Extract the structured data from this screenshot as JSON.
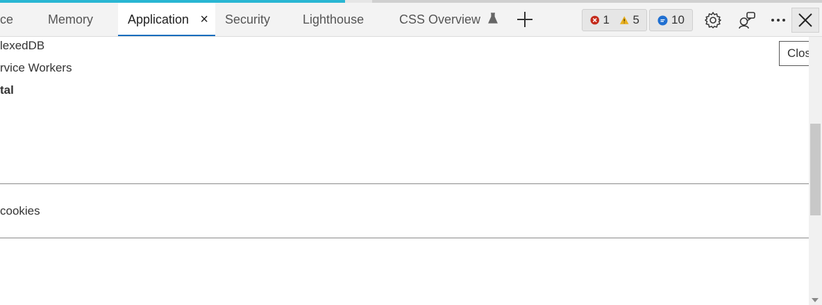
{
  "tabs": [
    {
      "label": "ce"
    },
    {
      "label": "Memory"
    },
    {
      "label": "Application",
      "close": "×"
    },
    {
      "label": "Security"
    },
    {
      "label": "Lighthouse"
    },
    {
      "label": "CSS Overview"
    }
  ],
  "badges": {
    "errors": "1",
    "warnings": "5",
    "issues": "10"
  },
  "tooltip": {
    "text": "Close"
  },
  "content": {
    "item1": "lexedDB",
    "item2": "rvice Workers",
    "item3": "tal",
    "item4": "cookies"
  },
  "colors": {
    "accent": "#0f6cbd",
    "error": "#c42b1c",
    "warning": "#e8b020",
    "info": "#1f6fd1",
    "progress": "#29b6d3"
  },
  "progress": {
    "loaded_fraction": 0.42
  }
}
